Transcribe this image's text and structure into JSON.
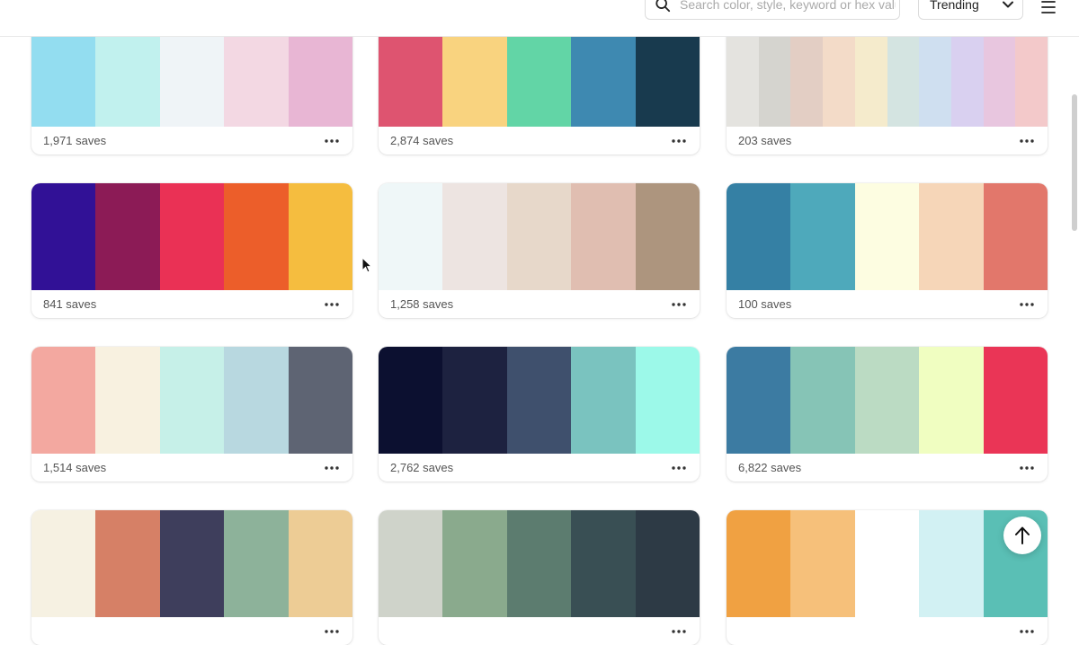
{
  "search": {
    "placeholder": "Search color, style, keyword or hex value",
    "icon": "search-icon"
  },
  "sort": {
    "selected": "Trending"
  },
  "palettes": [
    {
      "colors": [
        "#93DDF0",
        "#C1F1EE",
        "#EFF4F7",
        "#F3D8E3",
        "#E8B6D4"
      ],
      "saves": "1,971 saves"
    },
    {
      "colors": [
        "#DE5470",
        "#F9D37F",
        "#62D5A6",
        "#3E89B1",
        "#183A4E"
      ],
      "saves": "2,874 saves"
    },
    {
      "colors": [
        "#E4E3DF",
        "#D5D4CF",
        "#E3CEC4",
        "#F3DBC8",
        "#F5EBCC",
        "#D4E4E1",
        "#CFDFF0",
        "#D9D0F0",
        "#E8C6DF",
        "#F3C9CA"
      ],
      "saves": "203 saves"
    },
    {
      "colors": [
        "#311196",
        "#8C1B56",
        "#EA3155",
        "#EC5E2A",
        "#F5BD3F"
      ],
      "saves": "841 saves"
    },
    {
      "colors": [
        "#EFF7F8",
        "#EDE4E1",
        "#E7D8CA",
        "#E0BEB1",
        "#AD957E"
      ],
      "saves": "1,258 saves"
    },
    {
      "colors": [
        "#3580A4",
        "#4EA9BB",
        "#FDFDE1",
        "#F6D6B8",
        "#E2776B"
      ],
      "saves": "100 saves"
    },
    {
      "colors": [
        "#F3A8A0",
        "#F8F1E0",
        "#C6F0E8",
        "#B8D8E0",
        "#5E6473"
      ],
      "saves": "1,514 saves"
    },
    {
      "colors": [
        "#0C1030",
        "#1D2240",
        "#3F506D",
        "#7AC3BF",
        "#9CF9E9"
      ],
      "saves": "2,762 saves"
    },
    {
      "colors": [
        "#3C7BA2",
        "#86C4B6",
        "#BBDBC3",
        "#F0FEC1",
        "#EA3556"
      ],
      "saves": "6,822 saves"
    },
    {
      "colors": [
        "#F6F1E2",
        "#D68066",
        "#3E3E5C",
        "#8DB29A",
        "#EDCC95"
      ],
      "saves": ""
    },
    {
      "colors": [
        "#CFD3CA",
        "#8AAA8D",
        "#5C7C6F",
        "#394F54",
        "#2D3A45"
      ],
      "saves": ""
    },
    {
      "colors": [
        "#F0A142",
        "#F6C07A",
        "#FFFFFF",
        "#D2F1F3",
        "#5ABFB5"
      ],
      "saves": ""
    }
  ]
}
